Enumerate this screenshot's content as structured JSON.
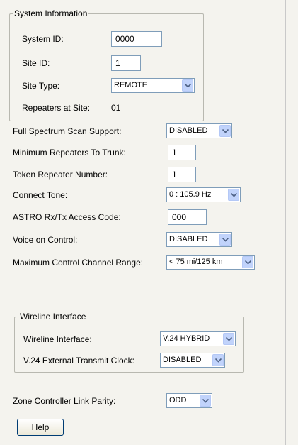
{
  "system_info": {
    "legend": "System Information",
    "system_id_label": "System ID:",
    "system_id_value": "0000",
    "site_id_label": "Site ID:",
    "site_id_value": "1",
    "site_type_label": "Site Type:",
    "site_type_value": "REMOTE",
    "repeaters_label": "Repeaters at Site:",
    "repeaters_value": "01"
  },
  "fields": {
    "full_spectrum_label": "Full Spectrum Scan Support:",
    "full_spectrum_value": "DISABLED",
    "min_repeaters_label": "Minimum Repeaters To Trunk:",
    "min_repeaters_value": "1",
    "token_repeater_label": "Token Repeater Number:",
    "token_repeater_value": "1",
    "connect_tone_label": "Connect Tone:",
    "connect_tone_value": "0 : 105.9 Hz",
    "astro_label": "ASTRO Rx/Tx Access Code:",
    "astro_value": "000",
    "voice_control_label": "Voice on Control:",
    "voice_control_value": "DISABLED",
    "max_range_label": "Maximum Control Channel Range:",
    "max_range_value": "< 75 mi/125 km"
  },
  "wireline": {
    "legend": "Wireline Interface",
    "interface_label": "Wireline Interface:",
    "interface_value": "V.24 HYBRID",
    "clock_label": "V.24 External Transmit Clock:",
    "clock_value": "DISABLED"
  },
  "zone": {
    "parity_label": "Zone Controller Link Parity:",
    "parity_value": "ODD"
  },
  "help_label": "Help",
  "icons": {
    "dropdown": "chevron-down-icon"
  }
}
